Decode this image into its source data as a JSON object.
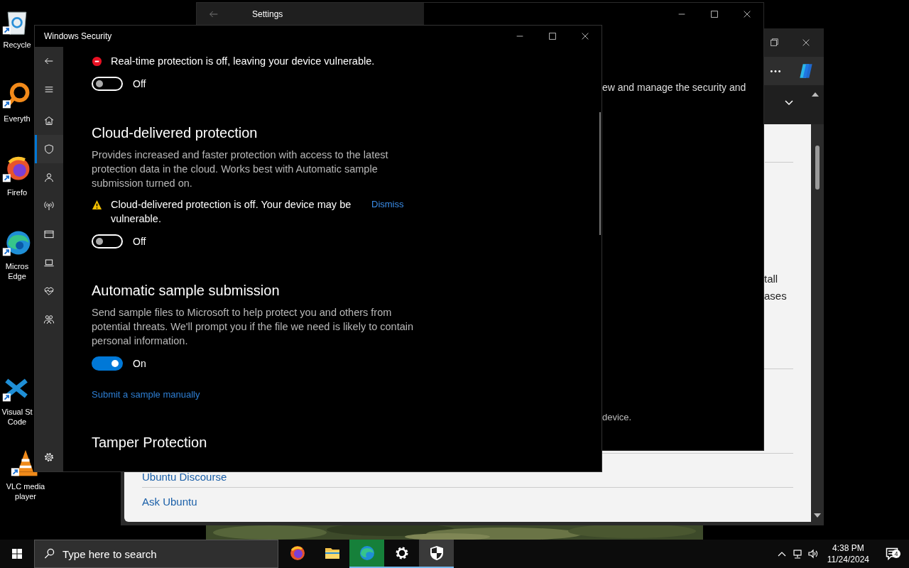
{
  "desktop_icons": [
    {
      "kind": "recycle",
      "label": "Recycle"
    },
    {
      "kind": "search",
      "label": "Everyth"
    },
    {
      "kind": "firefox",
      "label": "Firefo"
    },
    {
      "kind": "edge",
      "label": "Micros Edge"
    },
    {
      "kind": "vscode",
      "label": "Visual St Code"
    },
    {
      "kind": "vlc",
      "label": "VLC media player"
    }
  ],
  "browser": {
    "texts": [
      "tall",
      "ases"
    ],
    "links": [
      "Ubuntu Discourse",
      "Ask Ubuntu"
    ]
  },
  "settings_window": {
    "title": "Settings",
    "texts": [
      "ew and manage the security and",
      "device."
    ]
  },
  "security_window": {
    "title": "Windows Security",
    "nav_top": [
      {
        "kind": "back"
      },
      {
        "kind": "menu"
      }
    ],
    "nav": [
      {
        "kind": "home",
        "selected": false
      },
      {
        "kind": "shield",
        "selected": true
      },
      {
        "kind": "person",
        "selected": false
      },
      {
        "kind": "wireless",
        "selected": false
      },
      {
        "kind": "window",
        "selected": false
      },
      {
        "kind": "laptop",
        "selected": false
      },
      {
        "kind": "heart",
        "selected": false
      },
      {
        "kind": "family",
        "selected": false
      }
    ],
    "nav_bottom": [
      {
        "kind": "settings",
        "selected": false
      }
    ],
    "sections": [
      {
        "alert": {
          "kind": "error",
          "text": "Real-time protection is off, leaving your device vulnerable."
        },
        "toggle": {
          "on": false,
          "label": "Off"
        }
      },
      {
        "heading": "Cloud-delivered protection",
        "description": "Provides increased and faster protection with access to the latest protection data in the cloud. Works best with Automatic sample submission turned on.",
        "alert": {
          "kind": "warning",
          "text": "Cloud-delivered protection is off. Your device may be vulnerable.",
          "action": "Dismiss"
        },
        "toggle": {
          "on": false,
          "label": "Off"
        }
      },
      {
        "heading": "Automatic sample submission",
        "description": "Send sample files to Microsoft to help protect you and others from potential threats. We'll prompt you if the file we need is likely to contain personal information.",
        "toggle": {
          "on": true,
          "label": "On"
        },
        "link": "Submit a sample manually"
      },
      {
        "heading": "Tamper Protection"
      }
    ]
  },
  "taskbar": {
    "search": {
      "placeholder": "Type here to search"
    },
    "apps": [
      {
        "kind": "firefox",
        "running": false,
        "active": false
      },
      {
        "kind": "folder",
        "running": false,
        "active": false
      },
      {
        "kind": "edge",
        "running": true,
        "active": false
      },
      {
        "kind": "settings",
        "running": true,
        "active": false
      },
      {
        "kind": "shield",
        "running": true,
        "active": true
      }
    ],
    "clock": {
      "time": "4:38 PM",
      "date": "11/24/2024"
    },
    "notifications": {
      "count": "4"
    }
  }
}
